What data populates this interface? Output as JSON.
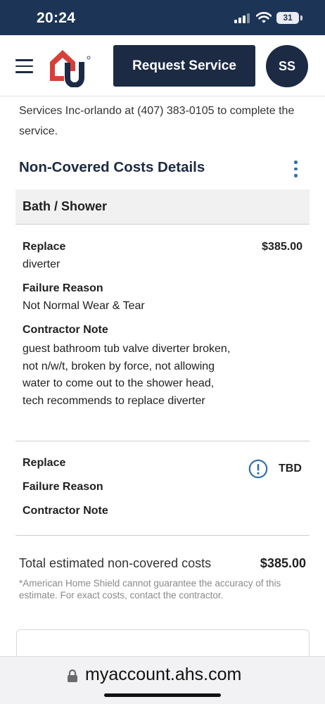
{
  "status_bar": {
    "time": "20:24",
    "battery": "31"
  },
  "header": {
    "request_service_label": "Request Service",
    "avatar_initials": "SS"
  },
  "intro_text": "Services Inc-orlando at (407) 383-0105 to complete the service.",
  "section_title": "Non-Covered Costs Details",
  "category": "Bath / Shower",
  "items": [
    {
      "action_label": "Replace",
      "part": "diverter",
      "price": "$385.00",
      "failure_reason_label": "Failure Reason",
      "failure_reason": "Not Normal Wear & Tear",
      "contractor_note_label": "Contractor Note",
      "contractor_note": "guest bathroom tub valve diverter broken, not n/w/t, broken by force, not allowing water to come out to the shower head, tech recommends to replace diverter"
    },
    {
      "action_label": "Replace",
      "price": "TBD",
      "failure_reason_label": "Failure Reason",
      "contractor_note_label": "Contractor Note"
    }
  ],
  "total": {
    "label": "Total estimated non-covered costs",
    "amount": "$385.00",
    "disclaimer": "*American Home Shield cannot guarantee the accuracy of this estimate. For exact costs, contact the contractor."
  },
  "browser": {
    "url": "myaccount.ahs.com"
  },
  "colors": {
    "navy": "#1c2a44",
    "status_bar": "#1c3557",
    "accent_blue": "#2f6fb0",
    "logo_red": "#d6403a"
  }
}
